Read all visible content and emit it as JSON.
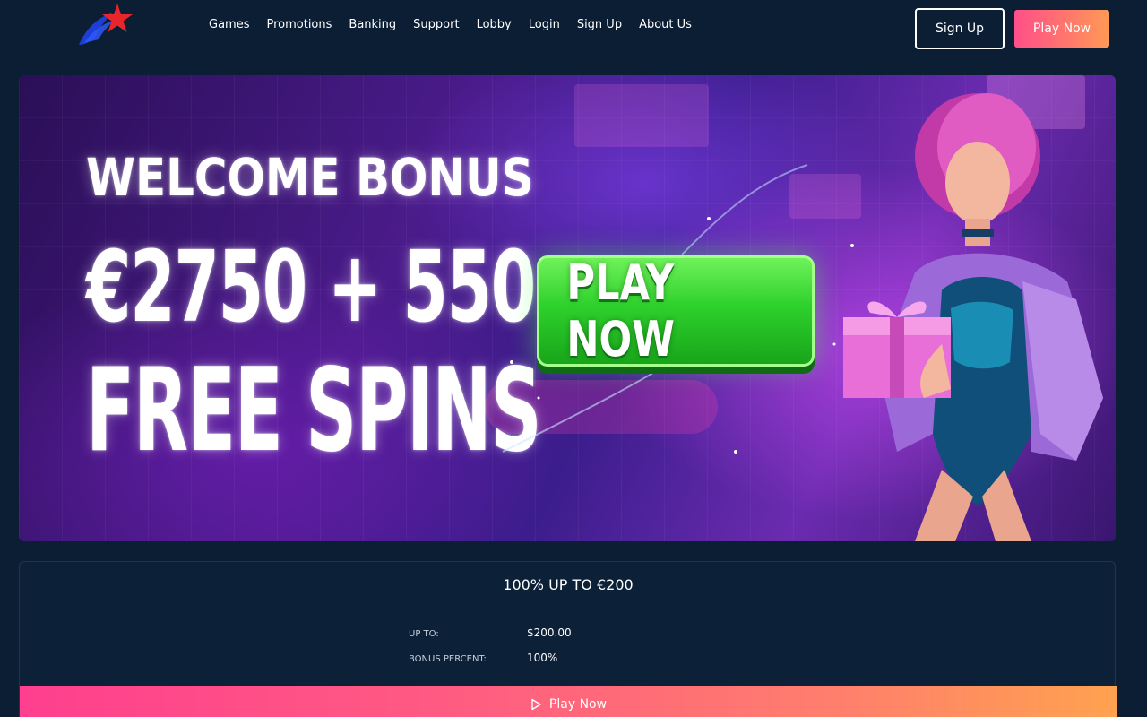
{
  "header": {
    "nav": [
      "Games",
      "Promotions",
      "Banking",
      "Support",
      "Lobby",
      "Login",
      "Sign Up",
      "About Us"
    ],
    "signup_label": "Sign Up",
    "playnow_label": "Play Now"
  },
  "banner": {
    "line1": "WELCOME BONUS",
    "line2": "€2750 + 550",
    "line3": "FREE SPINS",
    "cta": "PLAY NOW"
  },
  "bonus": {
    "title": "100% UP TO €200",
    "rows": [
      {
        "label": "UP TO:",
        "value": "$200.00"
      },
      {
        "label": "BONUS PERCENT:",
        "value": "100%"
      }
    ],
    "play_label": "Play Now"
  },
  "colors": {
    "page_bg": "#0b1e33",
    "accent_pink": "#ff4f8a",
    "accent_orange": "#ff9a55",
    "cta_green": "#2ed12c",
    "logo_red": "#e8252b",
    "logo_blue": "#1d3fd6"
  },
  "icons": [
    "star-logo-icon",
    "play-icon"
  ]
}
